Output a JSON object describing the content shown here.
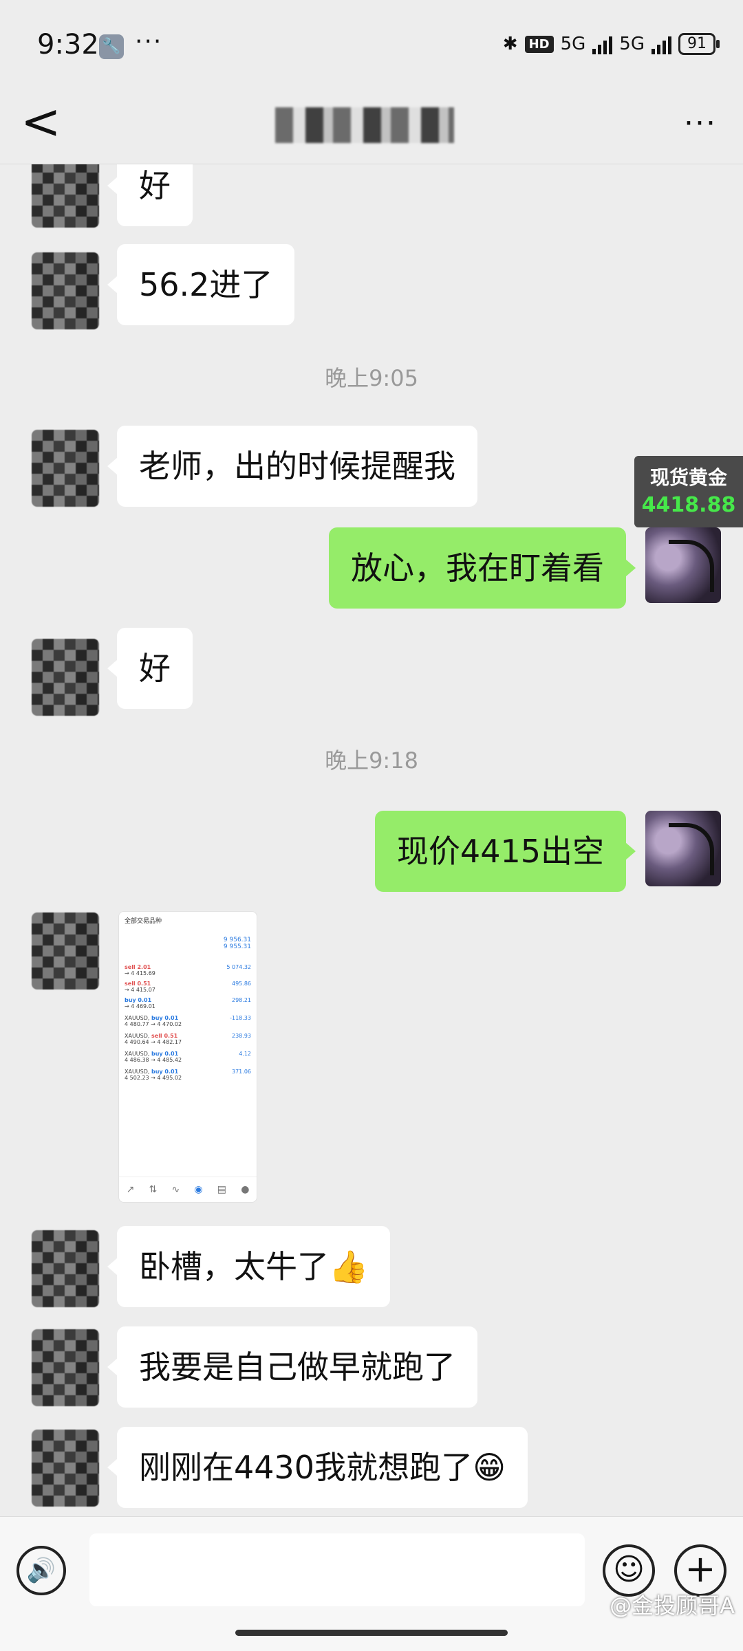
{
  "status_bar": {
    "time": "9:32",
    "more": "···",
    "hd": "HD",
    "net1": "5G",
    "net2": "5G",
    "battery": "91"
  },
  "nav": {
    "back": "<",
    "more": "···"
  },
  "messages": {
    "m1": "好",
    "m2": "56.2进了",
    "t1": "晚上9:05",
    "m3": "老师，出的时候提醒我",
    "m4": "放心，我在盯着看",
    "m5": "好",
    "t2": "晚上9:18",
    "m6": "现价4415出空",
    "m7": "卧槽，太牛了👍",
    "m8": "我要是自己做早就跑了",
    "m9": "刚刚在4430我就想跑了😁"
  },
  "gold_widget": {
    "label": "现货黄金",
    "price": "4418.88",
    "price_color": "#46e84a"
  },
  "screenshot_thumb": {
    "header": "全部交易品种",
    "balance1": "9 956.31",
    "balance2": "9 955.31",
    "rows": [
      {
        "sym": "",
        "side": "sell 2.01",
        "range": "→ 4 415.69",
        "val": "5 074.32"
      },
      {
        "sym": "",
        "side": "sell 0.51",
        "range": "→ 4 415.07",
        "val": "495.86"
      },
      {
        "sym": "",
        "side": "buy 0.01",
        "range": "→ 4 469.01",
        "val": "298.21"
      },
      {
        "sym": "XAUUSD,",
        "side": "buy 0.01",
        "range": "4 480.77 → 4 470.02",
        "val": "-118.33"
      },
      {
        "sym": "XAUUSD,",
        "side": "sell 0.51",
        "range": "4 490.64 → 4 482.17",
        "val": "238.93"
      },
      {
        "sym": "XAUUSD,",
        "side": "buy 0.01",
        "range": "4 486.38 → 4 485.42",
        "val": "4.12"
      },
      {
        "sym": "XAUUSD,",
        "side": "buy 0.01",
        "range": "4 502.23 → 4 495.02",
        "val": "371.06"
      }
    ]
  },
  "input": {
    "voice_icon": "voice-icon",
    "emoji_icon": "emoji-icon",
    "plus_icon": "plus-icon"
  },
  "watermark": "@金投顾哥A"
}
